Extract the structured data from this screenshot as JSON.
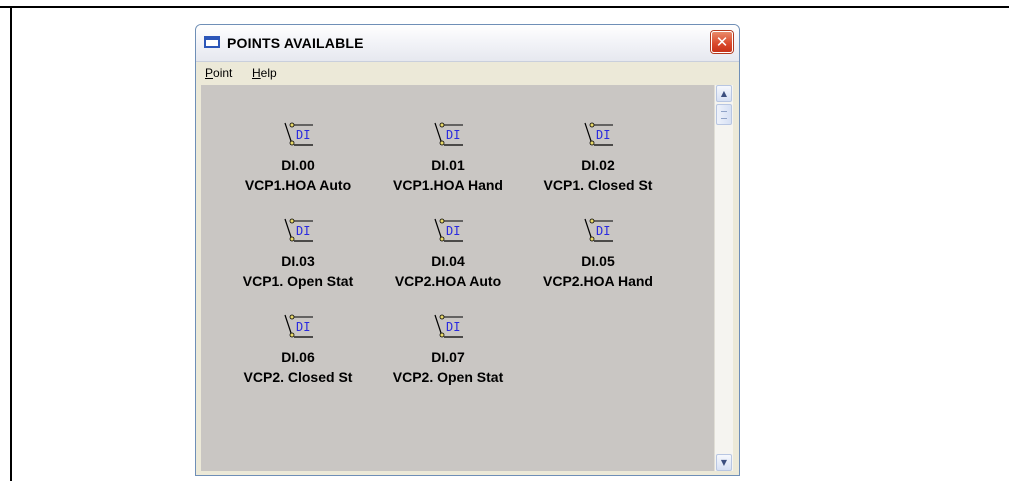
{
  "window": {
    "title": "POINTS AVAILABLE",
    "close_label": "✕"
  },
  "menu": [
    {
      "label": "Point",
      "accel": "P",
      "rest": "oint"
    },
    {
      "label": "Help",
      "accel": "H",
      "rest": "elp"
    }
  ],
  "points": [
    {
      "icon": "digital-input-icon",
      "icon_text": "DI",
      "code": "DI.00",
      "desc": "VCP1.HOA Auto"
    },
    {
      "icon": "digital-input-icon",
      "icon_text": "DI",
      "code": "DI.01",
      "desc": "VCP1.HOA Hand"
    },
    {
      "icon": "digital-input-icon",
      "icon_text": "DI",
      "code": "DI.02",
      "desc": "VCP1. Closed St"
    },
    {
      "icon": "digital-input-icon",
      "icon_text": "DI",
      "code": "DI.03",
      "desc": "VCP1. Open Stat"
    },
    {
      "icon": "digital-input-icon",
      "icon_text": "DI",
      "code": "DI.04",
      "desc": "VCP2.HOA Auto"
    },
    {
      "icon": "digital-input-icon",
      "icon_text": "DI",
      "code": "DI.05",
      "desc": "VCP2.HOA Hand"
    },
    {
      "icon": "digital-input-icon",
      "icon_text": "DI",
      "code": "DI.06",
      "desc": "VCP2. Closed St"
    },
    {
      "icon": "digital-input-icon",
      "icon_text": "DI",
      "code": "DI.07",
      "desc": "VCP2. Open Stat"
    }
  ],
  "colors": {
    "client_bg": "#c9c6c3",
    "icon_text": "#2a2adf",
    "icon_stroke": "#000000",
    "icon_contact": "#e8d96a"
  }
}
